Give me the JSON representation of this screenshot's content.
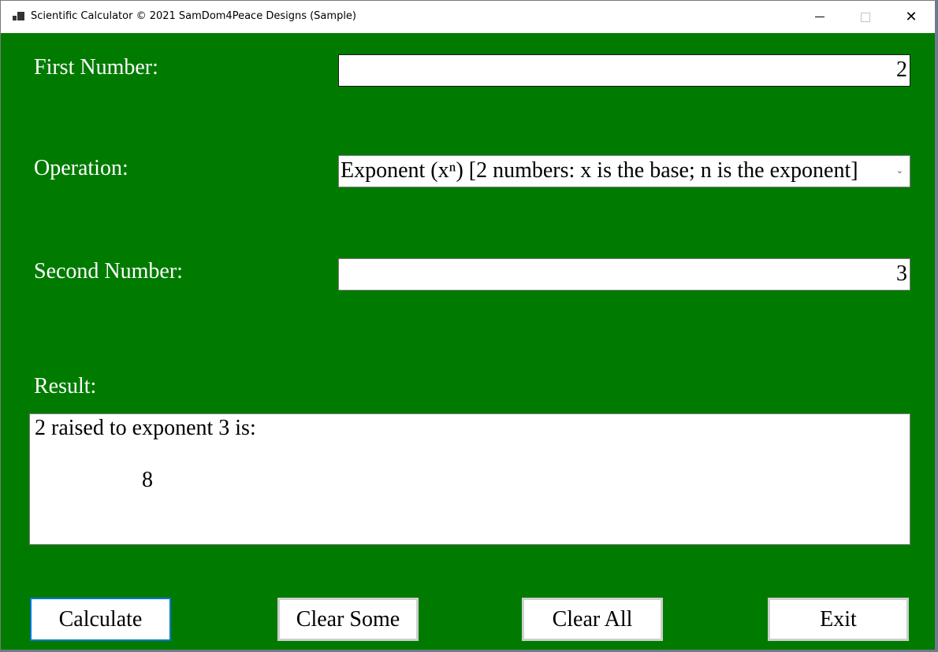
{
  "window": {
    "title": "Scientific Calculator © 2021 SamDom4Peace Designs (Sample)",
    "controls": {
      "minimize": "—",
      "maximize": "□",
      "close": "✕"
    }
  },
  "form": {
    "first_number": {
      "label": "First Number:",
      "value": "2"
    },
    "operation": {
      "label": "Operation:",
      "selected": "Exponent (xⁿ) [2 numbers: x is the base; n is the exponent]"
    },
    "second_number": {
      "label": "Second Number:",
      "value": "3"
    },
    "result": {
      "label": "Result:",
      "line1": "2 raised to exponent 3 is:",
      "line2": "8"
    }
  },
  "buttons": {
    "calculate": "Calculate",
    "clear_some": "Clear Some",
    "clear_all": "Clear All",
    "exit": "Exit"
  },
  "colors": {
    "background": "#007b00",
    "focus_border": "#0a74da"
  }
}
